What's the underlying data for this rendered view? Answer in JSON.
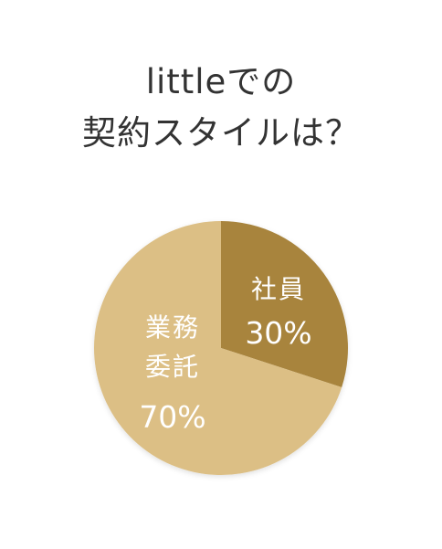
{
  "title": {
    "line1": "littleでの",
    "line2": "契約スタイルは？"
  },
  "chart_data": {
    "type": "pie",
    "categories": [
      "社員",
      "業務委託"
    ],
    "values": [
      30,
      70
    ],
    "labels": [
      {
        "name_lines": [
          "社員"
        ],
        "percent": "30%"
      },
      {
        "name_lines": [
          "業務",
          "委託"
        ],
        "percent": "70%"
      }
    ],
    "colors": [
      "#a8843e",
      "#dcbf85"
    ],
    "start_angle_deg": 0,
    "direction": "clockwise"
  }
}
